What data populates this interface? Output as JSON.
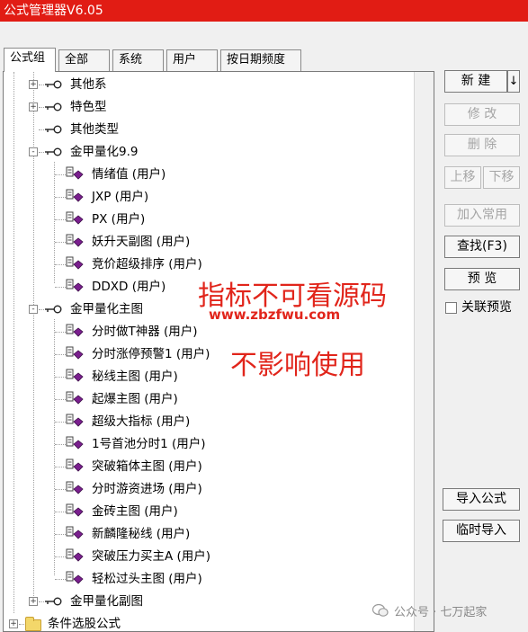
{
  "window": {
    "title": "公式管理器V6.05"
  },
  "tabs": [
    {
      "label": "公式组",
      "active": true
    },
    {
      "label": "全部"
    },
    {
      "label": "系统"
    },
    {
      "label": "用户"
    },
    {
      "label": "按日期频度"
    }
  ],
  "tree": {
    "nodes": [
      {
        "label": "其他系",
        "kind": "group",
        "expander": "+"
      },
      {
        "label": "特色型",
        "kind": "group",
        "expander": "+"
      },
      {
        "label": "其他类型",
        "kind": "group"
      },
      {
        "label": "金甲量化9.9",
        "kind": "group",
        "expander": "-"
      },
      {
        "label": "情绪值 (用户)",
        "kind": "formula"
      },
      {
        "label": "JXP (用户)",
        "kind": "formula"
      },
      {
        "label": "PX (用户)",
        "kind": "formula"
      },
      {
        "label": "妖升天副图 (用户)",
        "kind": "formula"
      },
      {
        "label": "竞价超级排序 (用户)",
        "kind": "formula"
      },
      {
        "label": "DDXD (用户)",
        "kind": "formula"
      },
      {
        "label": "金甲量化主图",
        "kind": "group",
        "expander": "-"
      },
      {
        "label": "分时做T神器 (用户)",
        "kind": "formula"
      },
      {
        "label": "分时涨停预警1 (用户)",
        "kind": "formula"
      },
      {
        "label": "秘线主图 (用户)",
        "kind": "formula"
      },
      {
        "label": "起爆主图 (用户)",
        "kind": "formula"
      },
      {
        "label": "超级大指标 (用户)",
        "kind": "formula"
      },
      {
        "label": "1号首池分时1 (用户)",
        "kind": "formula"
      },
      {
        "label": "突破箱体主图 (用户)",
        "kind": "formula"
      },
      {
        "label": "分时游资进场 (用户)",
        "kind": "formula"
      },
      {
        "label": "金砖主图 (用户)",
        "kind": "formula"
      },
      {
        "label": "新麟隆秘线 (用户)",
        "kind": "formula"
      },
      {
        "label": "突破压力买主A (用户)",
        "kind": "formula"
      },
      {
        "label": "轻松过头主图 (用户)",
        "kind": "formula"
      },
      {
        "label": "金甲量化副图",
        "kind": "group",
        "expander": "+"
      },
      {
        "label": "条件选股公式",
        "kind": "folder",
        "expander": "+"
      }
    ]
  },
  "buttons": {
    "new": "新 建",
    "new_arrow": "↓",
    "modify": "修 改",
    "delete": "删 除",
    "move_up": "上移",
    "move_down": "下移",
    "add_common": "加入常用",
    "find": "查找(F3)",
    "preview": "预 览",
    "import": "导入公式",
    "temp_import": "临时导入"
  },
  "link_preview": {
    "label": "关联预览",
    "checked": false
  },
  "overlay": {
    "line1": "指标不可看源码",
    "url": "www.zbzfwu.com",
    "line2": "不影响使用"
  },
  "watermark": "公众号 · 七万起家",
  "colors": {
    "titlebar": "#e11c14",
    "overlay_text": "#e1251b",
    "formula_icon": "#7a1f8e"
  }
}
